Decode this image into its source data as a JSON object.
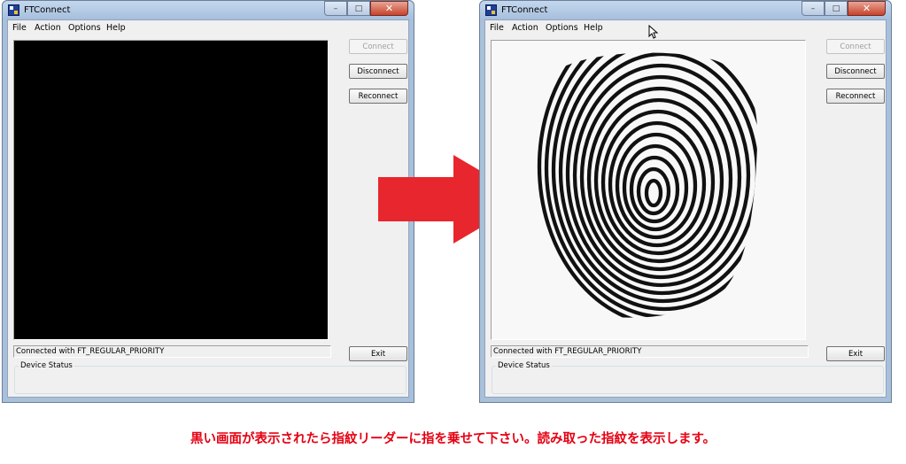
{
  "windows": [
    {
      "title": "FTConnect",
      "menu": [
        "File",
        "Action",
        "Options",
        "Help"
      ],
      "buttons": {
        "connect": "Connect",
        "disconnect": "Disconnect",
        "reconnect": "Reconnect",
        "exit": "Exit"
      },
      "status_text": "Connected with FT_REGULAR_PRIORITY",
      "group_label": "Device Status"
    },
    {
      "title": "FTConnect",
      "menu": [
        "File",
        "Action",
        "Options",
        "Help"
      ],
      "buttons": {
        "connect": "Connect",
        "disconnect": "Disconnect",
        "reconnect": "Reconnect",
        "exit": "Exit"
      },
      "status_text": "Connected with FT_REGULAR_PRIORITY",
      "group_label": "Device Status"
    }
  ],
  "caption": "黒い画面が表示されたら指紋リーダーに指を乗せて下さい。読み取った指紋を表示します。",
  "icons": [
    "app-icon",
    "minimize-icon",
    "maximize-icon",
    "close-icon",
    "arrow-right-icon",
    "mouse-cursor-icon",
    "fingerprint-image"
  ],
  "colors": {
    "arrow": "#e8262d",
    "caption": "#e60012",
    "title_bar": "#b6cbe6",
    "screen_black": "#000000"
  }
}
